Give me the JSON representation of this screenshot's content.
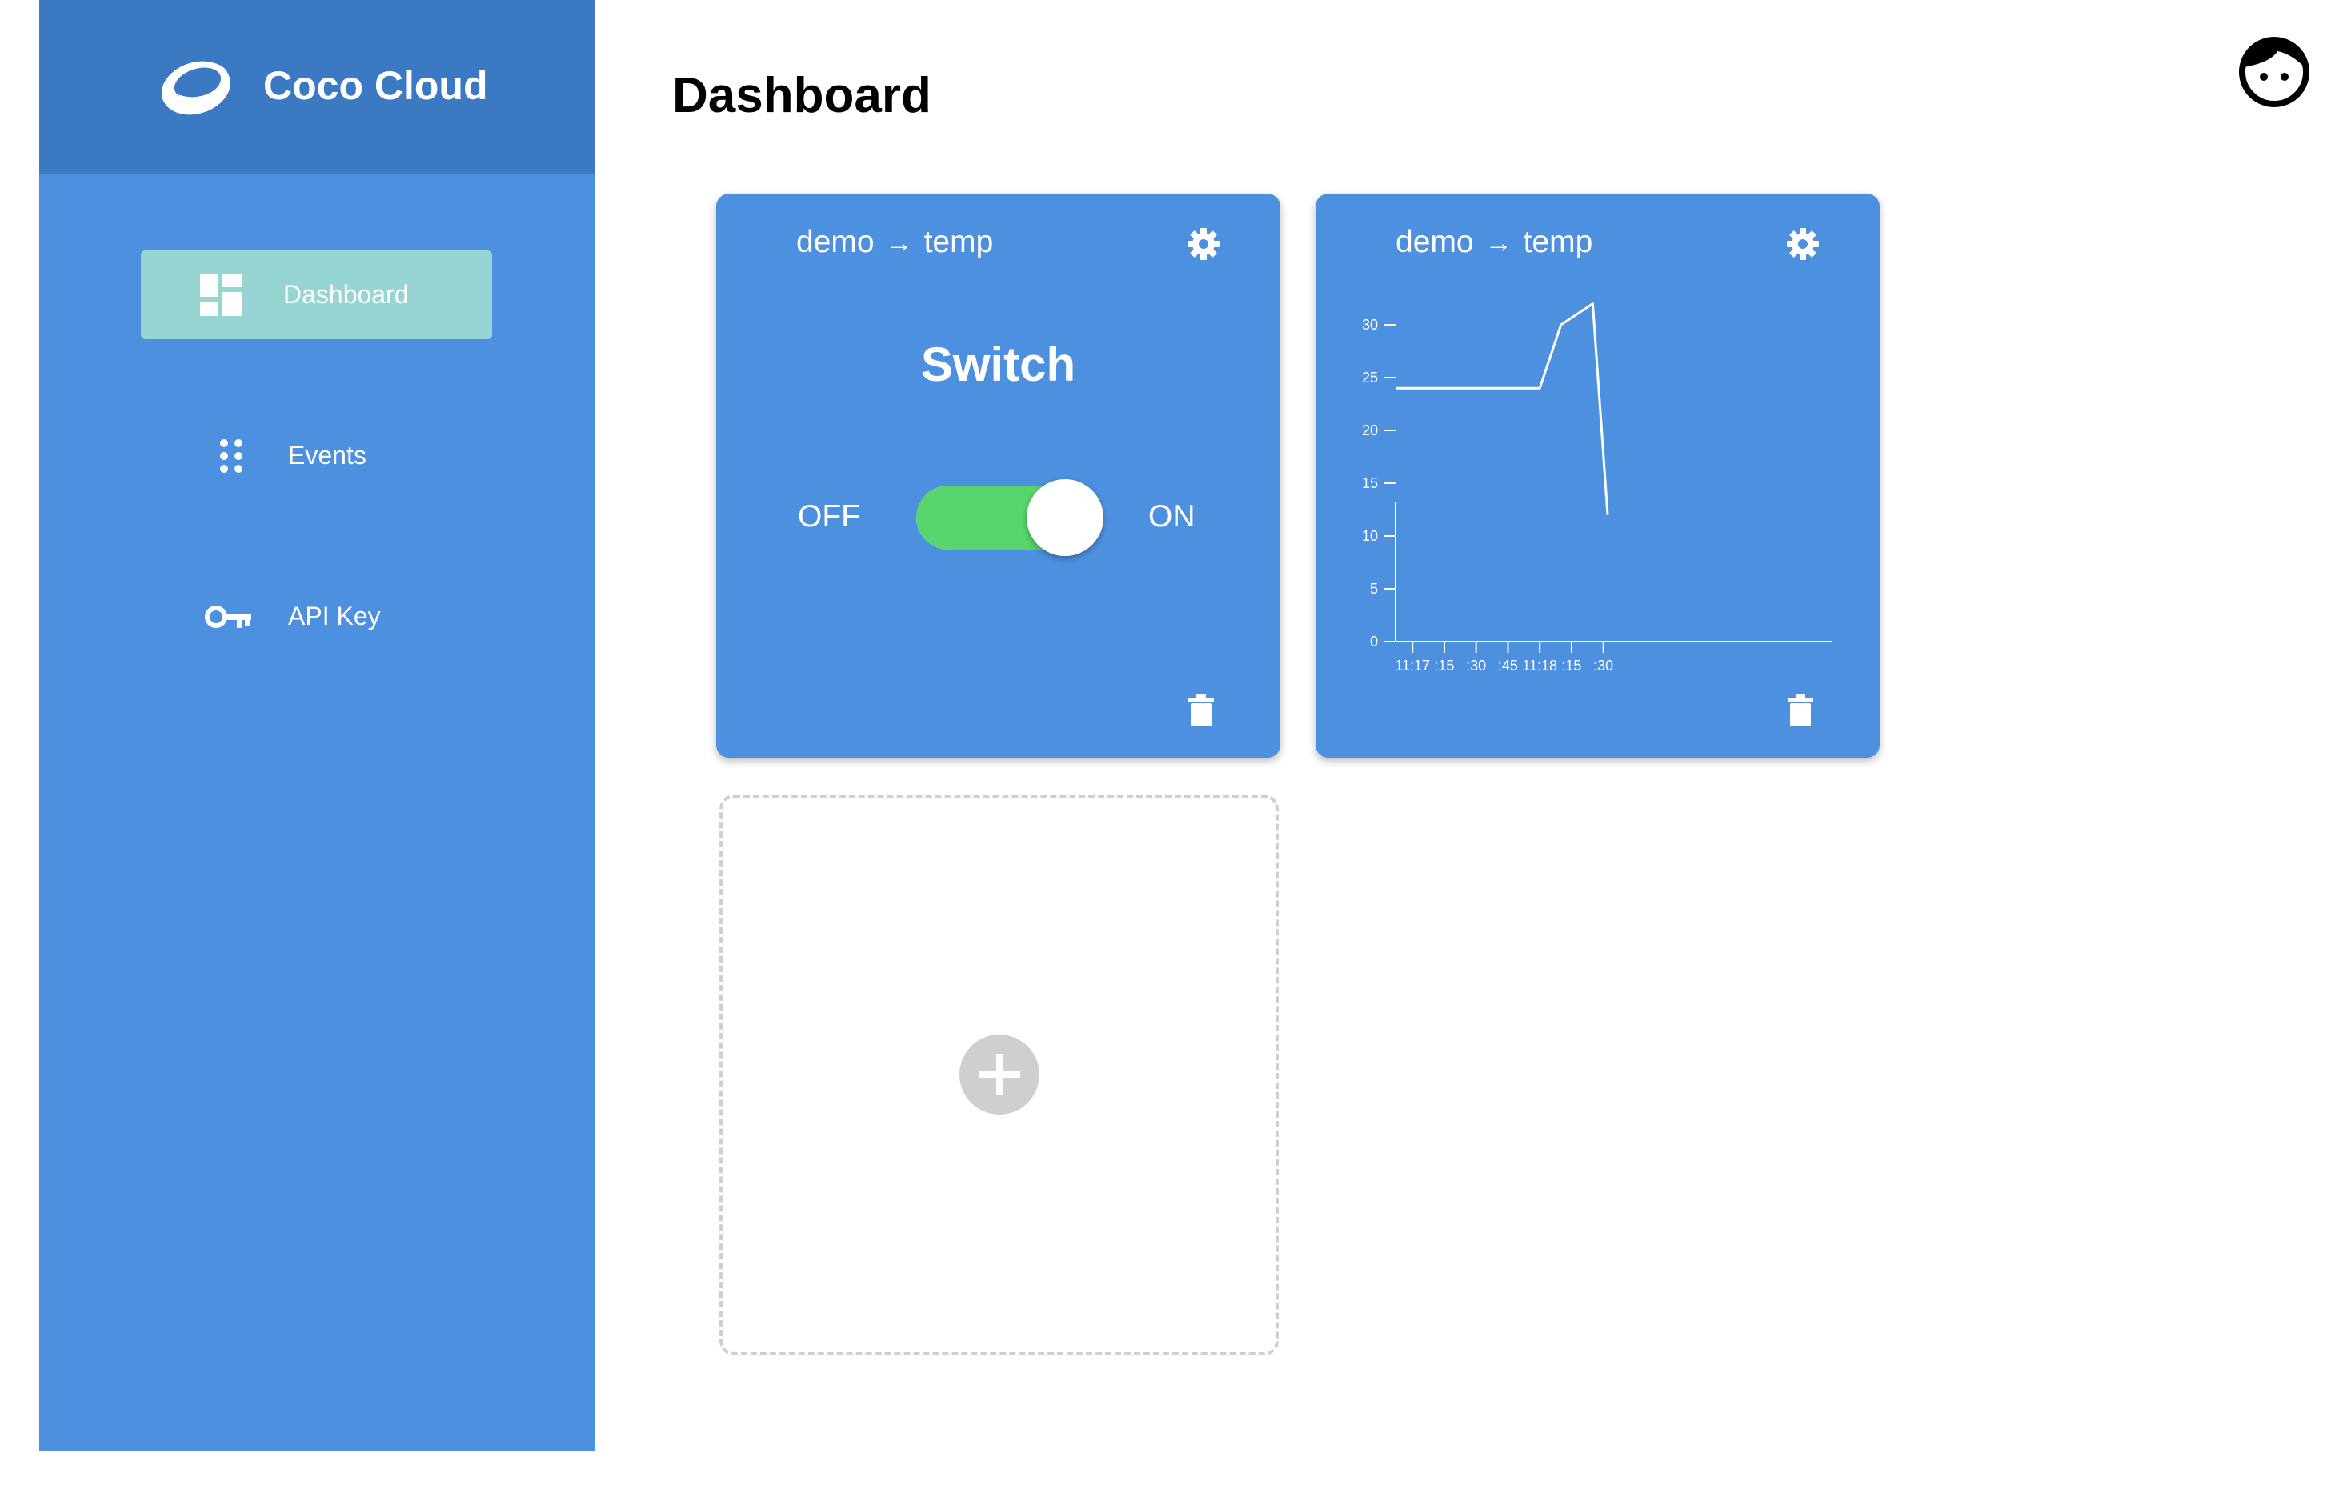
{
  "app": {
    "name": "Coco Cloud"
  },
  "sidebar": {
    "items": [
      {
        "label": "Dashboard",
        "icon": "dashboard-icon",
        "active": true
      },
      {
        "label": "Events",
        "icon": "dots-grid-icon",
        "active": false
      },
      {
        "label": "API Key",
        "icon": "key-icon",
        "active": false
      }
    ]
  },
  "header": {
    "title": "Dashboard",
    "avatar_icon": "user-face-icon"
  },
  "widgets": [
    {
      "type": "switch",
      "source": "demo",
      "arrow": "→",
      "target": "temp",
      "title": "Switch",
      "off_label": "OFF",
      "on_label": "ON",
      "state": "on"
    },
    {
      "type": "chart",
      "source": "demo",
      "arrow": "→",
      "target": "temp"
    }
  ],
  "add_widget": {
    "icon": "plus-icon"
  },
  "colors": {
    "sidebar": "#4e90e0",
    "sidebar_header": "#3b79c3",
    "active_item": "#97d5d2",
    "card": "#4e90e0",
    "toggle_on": "#57d56c"
  },
  "chart_data": {
    "type": "line",
    "x": [
      "11:17:00",
      "11:17:15",
      "11:17:30",
      "11:17:45",
      "11:18:00",
      "11:18:10",
      "11:18:25",
      "11:18:32"
    ],
    "y": [
      24,
      24,
      24,
      24,
      24,
      30,
      32,
      12
    ],
    "xticks": [
      "11:17",
      ":15",
      ":30",
      ":45",
      "11:18",
      ":15",
      ":30"
    ],
    "yticks": [
      0,
      5,
      10,
      15,
      20,
      25,
      30
    ],
    "ylim": [
      0,
      32
    ],
    "grid": false
  }
}
